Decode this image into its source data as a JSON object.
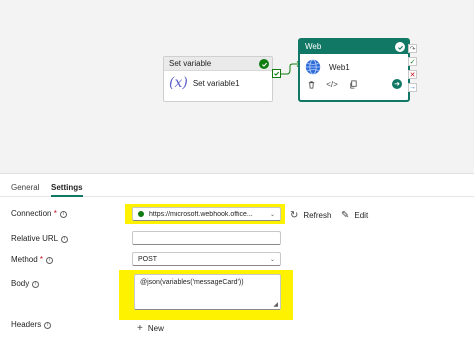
{
  "canvas": {
    "set_variable": {
      "title": "Set variable",
      "name": "Set variable1",
      "icon": "variable-fx-icon"
    },
    "web": {
      "title": "Web",
      "name": "Web1",
      "icon": "globe-icon"
    }
  },
  "tabs": [
    {
      "label": "General",
      "active": false
    },
    {
      "label": "Settings",
      "active": true
    }
  ],
  "form": {
    "connection": {
      "label": "Connection",
      "required_mark": "*",
      "value": "https://microsoft.webhook.office...",
      "refresh_label": "Refresh",
      "edit_label": "Edit"
    },
    "relative_url": {
      "label": "Relative URL",
      "value": ""
    },
    "method": {
      "label": "Method",
      "required_mark": "*",
      "value": "POST"
    },
    "body": {
      "label": "Body",
      "value": "@json(variables('messageCard'))"
    },
    "headers": {
      "label": "Headers",
      "new_label": "New"
    }
  },
  "colors": {
    "accent": "#117865",
    "success": "#107c10",
    "highlight": "#fff200",
    "error": "#c50f1f"
  }
}
